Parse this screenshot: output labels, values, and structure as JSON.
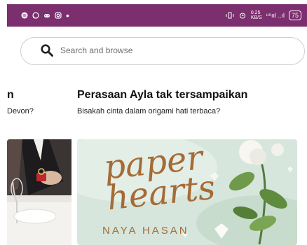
{
  "status_bar": {
    "clock": "0.25\nKB/S",
    "signal_text": "ᵘ⁵ııl ..ıl",
    "battery": "75"
  },
  "search": {
    "placeholder": "Search and browse"
  },
  "cards": [
    {
      "title": "n",
      "subtitle": "Devon?"
    },
    {
      "title": "Perasaan Ayla tak tersampaikan",
      "subtitle": "Bisakah cinta dalam origami hati terbaca?",
      "cover": {
        "title_line1": "paper",
        "title_line2": "hearts",
        "author": "NAYA HASAN"
      }
    }
  ],
  "colors": {
    "status_bar_bg": "#7b2f6e",
    "cover_bg": "#d6e6dc",
    "cover_text": "#a56b35"
  }
}
